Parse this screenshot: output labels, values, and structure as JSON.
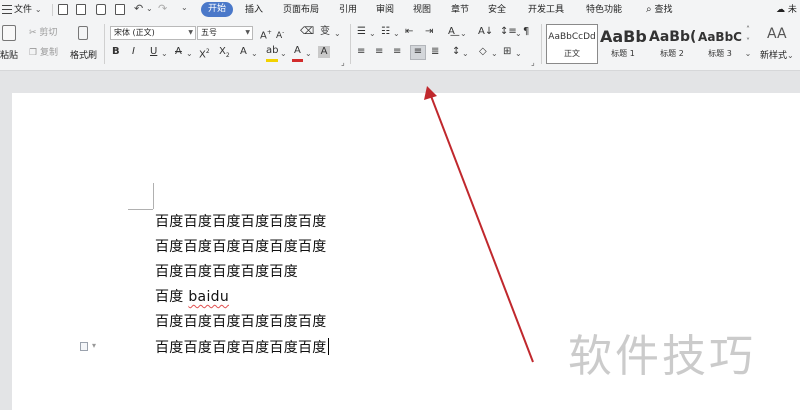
{
  "menubar": {
    "file_label": "文件",
    "tabs": [
      "开始",
      "插入",
      "页面布局",
      "引用",
      "审阅",
      "视图",
      "章节",
      "安全",
      "开发工具",
      "特色功能"
    ],
    "search_label": "查找",
    "account_label": "未"
  },
  "ribbon": {
    "paste_label": "粘贴",
    "cut_label": "剪切",
    "copy_label": "复制",
    "format_painter_label": "格式刷",
    "font_name": "宋体 (正文)",
    "font_size": "五号",
    "styles": [
      {
        "sample": "AaBbCcDd",
        "name": "正文"
      },
      {
        "sample": "AaBb",
        "name": "标题 1"
      },
      {
        "sample": "AaBb(",
        "name": "标题 2"
      },
      {
        "sample": "AaBbC",
        "name": "标题 3"
      }
    ],
    "new_style_label": "新样式",
    "new_style_icon": "AA"
  },
  "document": {
    "lines": [
      "百度百度百度百度百度百度",
      "百度百度百度百度百度百度",
      "百度百度百度百度百度",
      "百度",
      "百度百度百度百度百度百度",
      "百度百度百度百度百度百度"
    ],
    "line4_suffix": "baidu"
  },
  "annotation": {
    "arrow_color": "#c0282d"
  },
  "watermark": "软件技巧",
  "colors": {
    "accent_tab": "#4a78c9",
    "highlight_bar": "#f2d200",
    "font_color_bar": "#d22c2c"
  }
}
